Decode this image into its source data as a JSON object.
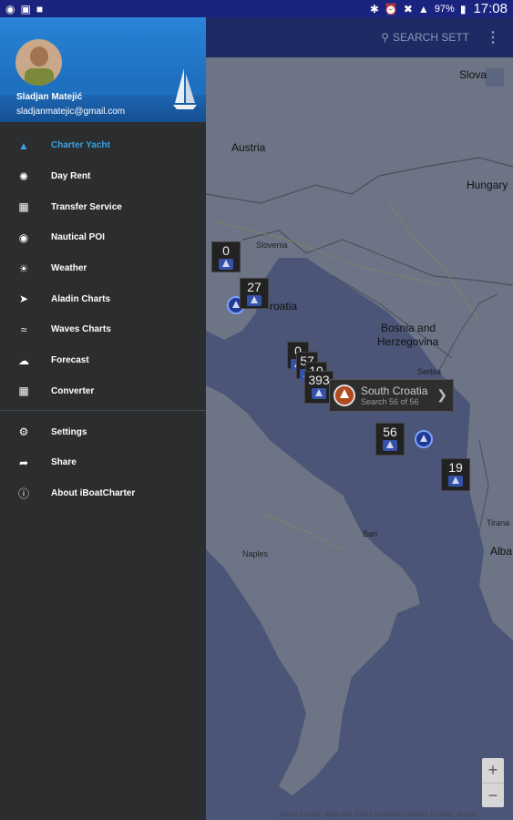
{
  "status_bar": {
    "battery": "97%",
    "time": "17:08"
  },
  "app_bar": {
    "search_label": "SEARCH SETT"
  },
  "drawer": {
    "user_name": "Sladjan Matejić",
    "user_email": "sladjanmatejic@gmail.com",
    "menu_primary": [
      {
        "label": "Charter Yacht",
        "icon": "sailboat-icon",
        "active": true
      },
      {
        "label": "Day Rent",
        "icon": "fan-icon",
        "active": false
      },
      {
        "label": "Transfer Service",
        "icon": "checkered-icon",
        "active": false
      },
      {
        "label": "Nautical POI",
        "icon": "location-pin-icon",
        "active": false
      },
      {
        "label": "Weather",
        "icon": "weather-icon",
        "active": false
      },
      {
        "label": "Aladin Charts",
        "icon": "aladin-icon",
        "active": false
      },
      {
        "label": "Waves Charts",
        "icon": "waves-icon",
        "active": false
      },
      {
        "label": "Forecast",
        "icon": "cloud-icon",
        "active": false
      },
      {
        "label": "Converter",
        "icon": "grid-icon",
        "active": false
      }
    ],
    "menu_secondary": [
      {
        "label": "Settings",
        "icon": "gear-icon"
      },
      {
        "label": "Share",
        "icon": "share-icon"
      },
      {
        "label": "About iBoatCharter",
        "icon": "info-icon"
      }
    ]
  },
  "map": {
    "labels": {
      "austria": "Austria",
      "hungary": "Hungary",
      "slovenia": "Slovenia",
      "croatia": "roatia",
      "slovakia": "Slova",
      "bosnia_1": "Bosnia and",
      "bosnia_2": "Herzegovina",
      "serbia": "Serbia",
      "albania": "Alba",
      "tirana": "Tirana",
      "bari": "Bari",
      "naples": "Naples"
    },
    "clusters": [
      "0",
      "27",
      "0",
      "57",
      "10",
      "393",
      "56",
      "19"
    ],
    "info_window": {
      "title": "South Croatia",
      "subtitle": "Search 56 of 56"
    },
    "credit": "©2016 Google · Map data ©2016 GeoBasis-DE/BKG (©2009), Google"
  }
}
